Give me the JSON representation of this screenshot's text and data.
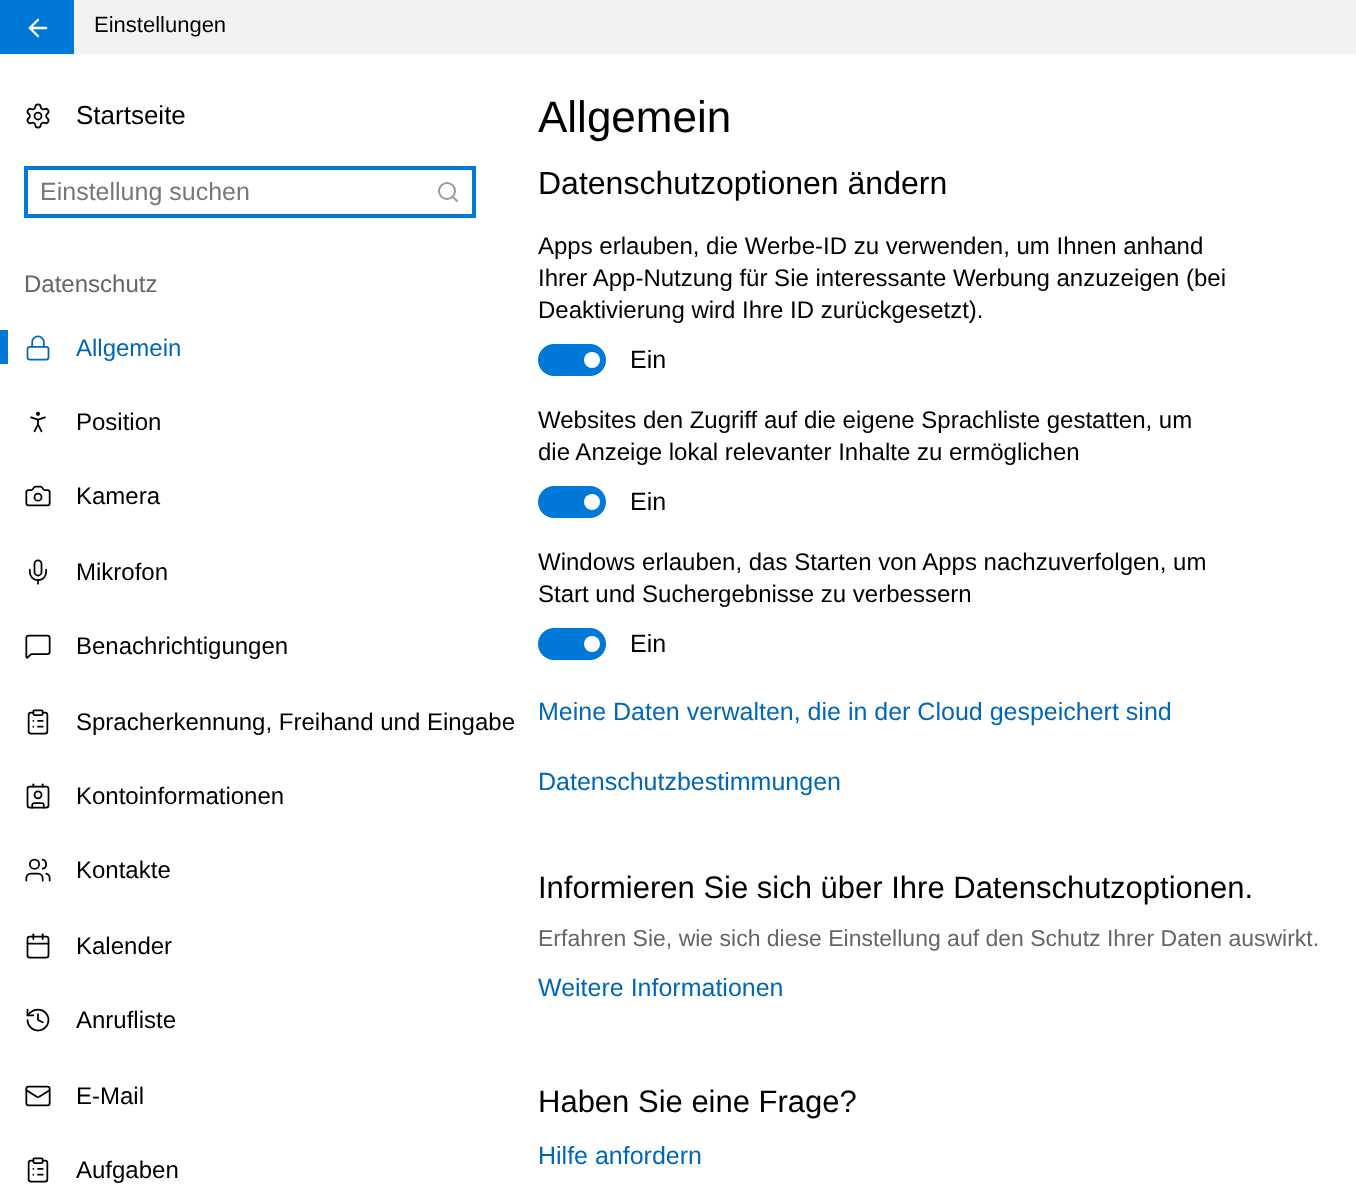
{
  "window": {
    "title": "Einstellungen"
  },
  "sidebar": {
    "home": "Startseite",
    "search": {
      "placeholder": "Einstellung suchen"
    },
    "section": "Datenschutz",
    "items": [
      {
        "label": "Allgemein",
        "selected": true
      },
      {
        "label": "Position",
        "selected": false
      },
      {
        "label": "Kamera",
        "selected": false
      },
      {
        "label": "Mikrofon",
        "selected": false
      },
      {
        "label": "Benachrichtigungen",
        "selected": false
      },
      {
        "label": "Spracherkennung, Freihand und Eingabe",
        "selected": false
      },
      {
        "label": "Kontoinformationen",
        "selected": false
      },
      {
        "label": "Kontakte",
        "selected": false
      },
      {
        "label": "Kalender",
        "selected": false
      },
      {
        "label": "Anrufliste",
        "selected": false
      },
      {
        "label": "E-Mail",
        "selected": false
      },
      {
        "label": "Aufgaben",
        "selected": false
      }
    ]
  },
  "main": {
    "title": "Allgemein",
    "subtitle": "Datenschutzoptionen ändern",
    "settings": [
      {
        "text": "Apps erlauben, die Werbe-ID zu verwenden, um Ihnen anhand Ihrer App-Nutzung für Sie interessante Werbung anzuzeigen (bei Deaktivierung wird Ihre ID zurückgesetzt).",
        "on": true,
        "state_label": "Ein"
      },
      {
        "text": "Websites den Zugriff auf die eigene Sprachliste gestatten, um die Anzeige lokal relevanter Inhalte zu ermöglichen",
        "on": true,
        "state_label": "Ein"
      },
      {
        "text": "Windows erlauben, das Starten von Apps nachzuverfolgen, um Start und Suchergebnisse zu verbessern",
        "on": true,
        "state_label": "Ein"
      }
    ],
    "links": [
      "Meine Daten verwalten, die in der Cloud gespeichert sind",
      "Datenschutzbestimmungen"
    ],
    "info": {
      "title": "Informieren Sie sich über Ihre Datenschutzoptionen.",
      "text": "Erfahren Sie, wie sich diese Einstellung auf den Schutz Ihrer Daten auswirkt.",
      "link": "Weitere Informationen"
    },
    "help": {
      "title": "Haben Sie eine Frage?",
      "link": "Hilfe anfordern"
    }
  }
}
